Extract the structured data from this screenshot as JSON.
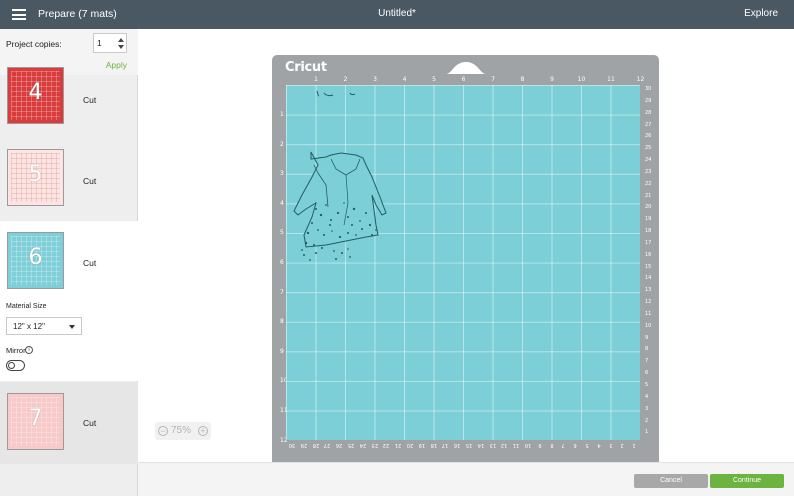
{
  "header": {
    "title": "Prepare (7 mats)",
    "document_title": "Untitled*",
    "explore_label": "Explore"
  },
  "sidebar": {
    "copies_label": "Project copies:",
    "copies_value": "1",
    "apply_label": "Apply",
    "mats": [
      {
        "number": "4",
        "label": "Cut",
        "color": "#d93c3c"
      },
      {
        "number": "5",
        "label": "Cut",
        "color": "#fbe4e2"
      },
      {
        "number": "6",
        "label": "Cut",
        "color": "#7fcfd9",
        "selected": true
      },
      {
        "number": "7",
        "label": "Cut",
        "color": "#f8c9c9"
      }
    ],
    "material_size_label": "Material Size",
    "material_size_value": "12\" x 12\"",
    "mirror_label": "Mirror",
    "mirror_on": false
  },
  "canvas": {
    "zoom": "75%",
    "mat_brand": "Cricut",
    "mat_color": "#7ccfd7",
    "ruler_top": [
      "1",
      "2",
      "3",
      "4",
      "5",
      "6",
      "7",
      "8",
      "9",
      "10",
      "11",
      "12"
    ],
    "ruler_left": [
      "1",
      "2",
      "3",
      "4",
      "5",
      "6",
      "7",
      "8",
      "9",
      "10",
      "11",
      "12"
    ],
    "ruler_right": [
      "30",
      "29",
      "28",
      "27",
      "26",
      "25",
      "24",
      "23",
      "22",
      "21",
      "20",
      "19",
      "18",
      "17",
      "16",
      "15",
      "14",
      "13",
      "12",
      "11",
      "10",
      "9",
      "8",
      "7",
      "6",
      "5",
      "4",
      "3",
      "2",
      "1"
    ],
    "ruler_bottom": [
      "30",
      "29",
      "28",
      "27",
      "26",
      "25",
      "24",
      "23",
      "22",
      "21",
      "20",
      "19",
      "18",
      "17",
      "16",
      "15",
      "14",
      "13",
      "12",
      "11",
      "10",
      "9",
      "8",
      "7",
      "6",
      "5",
      "4",
      "3",
      "2",
      "1"
    ]
  },
  "footer": {
    "cancel_label": "Cancel",
    "continue_label": "Continue",
    "continue_color": "#6db33f"
  }
}
